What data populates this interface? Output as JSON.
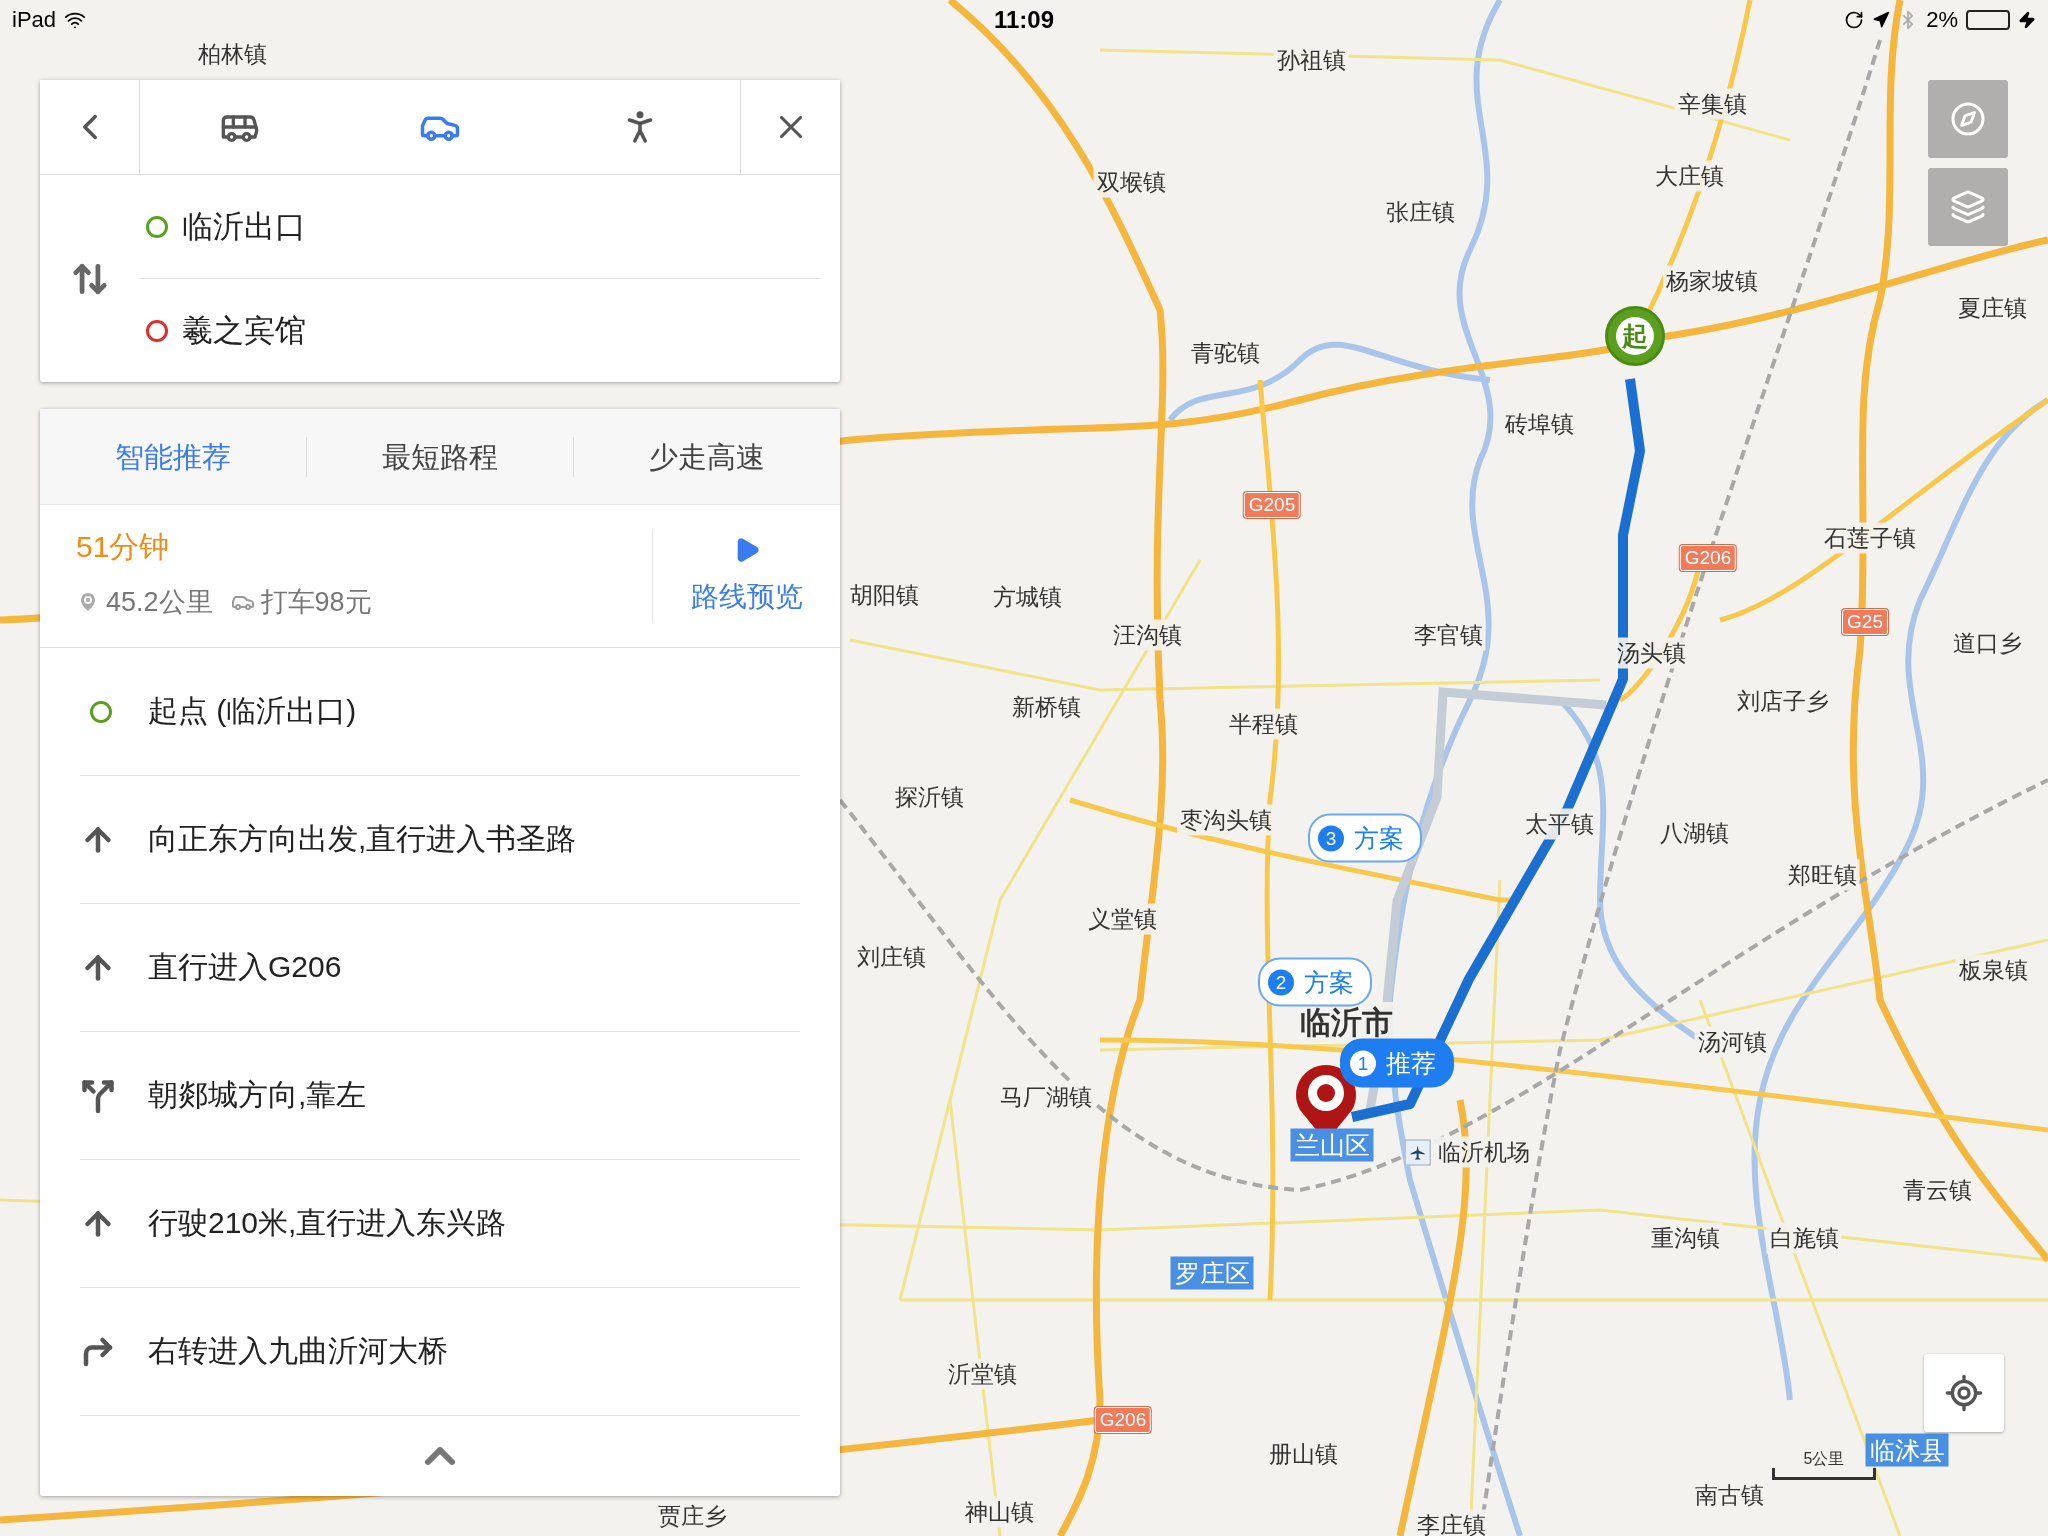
{
  "status_bar": {
    "device": "iPad",
    "time": "11:09",
    "battery": "2%"
  },
  "transport_modes": [
    {
      "kind": "bus",
      "selected": false
    },
    {
      "kind": "car",
      "selected": true
    },
    {
      "kind": "walk",
      "selected": false
    }
  ],
  "origin": "临沂出口",
  "destination": "羲之宾馆",
  "route_tabs": [
    {
      "label": "智能推荐",
      "selected": true
    },
    {
      "label": "最短路程",
      "selected": false
    },
    {
      "label": "少走高速",
      "selected": false
    }
  ],
  "summary": {
    "duration": "51分钟",
    "distance": "45.2公里",
    "taxi": "打车98元",
    "preview": "路线预览"
  },
  "steps": [
    {
      "kind": "start",
      "text": "起点 (临沂出口)"
    },
    {
      "kind": "straight",
      "text": "向正东方向出发,直行进入书圣路"
    },
    {
      "kind": "straight",
      "text": "直行进入G206"
    },
    {
      "kind": "fork_left",
      "text": "朝郯城方向,靠左"
    },
    {
      "kind": "straight",
      "text": "行驶210米,直行进入东兴路"
    },
    {
      "kind": "turn_right",
      "text": "右转进入九曲沂河大桥"
    }
  ],
  "map": {
    "places": [
      {
        "name": "柏林镇",
        "kind": "town"
      },
      {
        "name": "孙祖镇",
        "kind": "town"
      },
      {
        "name": "辛集镇",
        "kind": "town"
      },
      {
        "name": "双堠镇",
        "kind": "town"
      },
      {
        "name": "大庄镇",
        "kind": "town"
      },
      {
        "name": "张庄镇",
        "kind": "town"
      },
      {
        "name": "杨家坡镇",
        "kind": "town"
      },
      {
        "name": "夏庄镇",
        "kind": "town"
      },
      {
        "name": "青驼镇",
        "kind": "town"
      },
      {
        "name": "砖埠镇",
        "kind": "town"
      },
      {
        "name": "石莲子镇",
        "kind": "town"
      },
      {
        "name": "胡阳镇",
        "kind": "town"
      },
      {
        "name": "方城镇",
        "kind": "town"
      },
      {
        "name": "汪沟镇",
        "kind": "town"
      },
      {
        "name": "李官镇",
        "kind": "town"
      },
      {
        "name": "汤头镇",
        "kind": "town"
      },
      {
        "name": "道口乡",
        "kind": "town"
      },
      {
        "name": "刘店子乡",
        "kind": "town"
      },
      {
        "name": "新桥镇",
        "kind": "town"
      },
      {
        "name": "半程镇",
        "kind": "town"
      },
      {
        "name": "探沂镇",
        "kind": "town"
      },
      {
        "name": "枣沟头镇",
        "kind": "town"
      },
      {
        "name": "太平镇",
        "kind": "town"
      },
      {
        "name": "八湖镇",
        "kind": "town"
      },
      {
        "name": "郑旺镇",
        "kind": "town"
      },
      {
        "name": "义堂镇",
        "kind": "town"
      },
      {
        "name": "刘庄镇",
        "kind": "town"
      },
      {
        "name": "板泉镇",
        "kind": "town"
      },
      {
        "name": "临沂市",
        "kind": "city"
      },
      {
        "name": "汤河镇",
        "kind": "town"
      },
      {
        "name": "马厂湖镇",
        "kind": "town"
      },
      {
        "name": "兰山区",
        "kind": "district"
      },
      {
        "name": "临沂机场",
        "kind": "airport"
      },
      {
        "name": "青云镇",
        "kind": "town"
      },
      {
        "name": "重沟镇",
        "kind": "town"
      },
      {
        "name": "白旄镇",
        "kind": "town"
      },
      {
        "name": "罗庄区",
        "kind": "district"
      },
      {
        "name": "沂堂镇",
        "kind": "town"
      },
      {
        "name": "临沭县",
        "kind": "district"
      },
      {
        "name": "册山镇",
        "kind": "town"
      },
      {
        "name": "南古镇",
        "kind": "town"
      },
      {
        "name": "神山镇",
        "kind": "town"
      },
      {
        "name": "贾庄乡",
        "kind": "town"
      },
      {
        "name": "李庄镇",
        "kind": "town"
      }
    ],
    "highways": [
      "G205",
      "G206",
      "G25",
      "G206"
    ],
    "route_labels": [
      {
        "number": "3",
        "label": "方案",
        "selected": false
      },
      {
        "number": "2",
        "label": "方案",
        "selected": false
      },
      {
        "number": "1",
        "label": "推荐",
        "selected": true
      }
    ],
    "start_marker": "起",
    "scale": "5公里"
  }
}
